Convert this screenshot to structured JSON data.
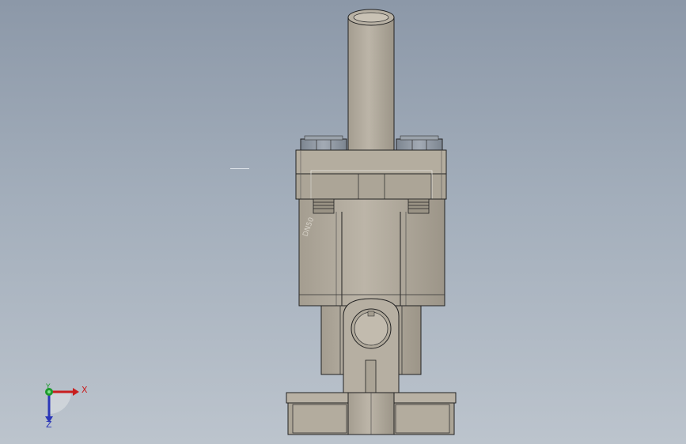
{
  "viewport": {
    "background_top": "#8c98a8",
    "background_bottom": "#bcc4cd"
  },
  "model": {
    "body_color": "#b2ab9e",
    "body_dark": "#958e80",
    "bolt_color": "#8d96a0",
    "engraving": "DN50"
  },
  "triad": {
    "x_label": "X",
    "y_label": "Y",
    "z_label": "Z",
    "x_color": "#c81e1e",
    "y_color": "#1e9a2e",
    "z_color": "#2a36b8"
  }
}
